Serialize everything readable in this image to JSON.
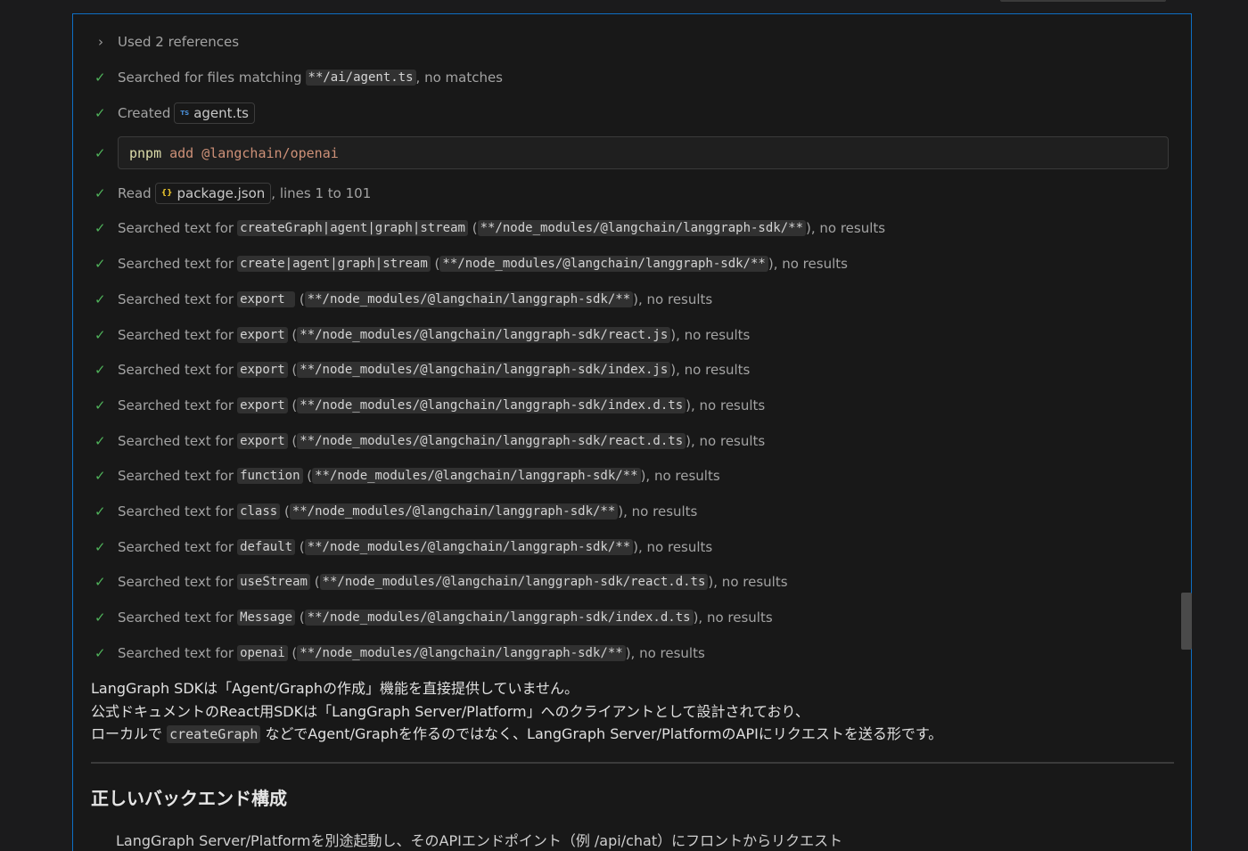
{
  "header": {
    "references_label": "Used 2 references"
  },
  "steps": [
    {
      "verb": "Searched for files matching",
      "code": "**/ai/agent.ts",
      "suffix": ", no matches"
    },
    {
      "verb": "Created",
      "file": "agent.ts",
      "file_icon": "typescript-icon",
      "file_icon_text": "TS"
    },
    {
      "command": {
        "bin": "pnpm",
        "args": "add @langchain/openai"
      }
    },
    {
      "verb": "Read",
      "file": "package.json",
      "file_icon": "json-icon",
      "file_icon_text": "{}",
      "suffix": ", lines 1 to 101"
    },
    {
      "verb": "Searched text for",
      "query": "createGraph|agent|graph|stream",
      "path": "**/node_modules/@langchain/langgraph-sdk/**",
      "suffix": "), no results"
    },
    {
      "verb": "Searched text for",
      "query": "create|agent|graph|stream",
      "path": "**/node_modules/@langchain/langgraph-sdk/**",
      "suffix": "), no results"
    },
    {
      "verb": "Searched text for",
      "query": "export ",
      "path": "**/node_modules/@langchain/langgraph-sdk/**",
      "suffix": "), no results"
    },
    {
      "verb": "Searched text for",
      "query": "export",
      "path": "**/node_modules/@langchain/langgraph-sdk/react.js",
      "suffix": "), no results"
    },
    {
      "verb": "Searched text for",
      "query": "export",
      "path": "**/node_modules/@langchain/langgraph-sdk/index.js",
      "suffix": "), no results"
    },
    {
      "verb": "Searched text for",
      "query": "export",
      "path": "**/node_modules/@langchain/langgraph-sdk/index.d.ts",
      "suffix": "), no results"
    },
    {
      "verb": "Searched text for",
      "query": "export",
      "path": "**/node_modules/@langchain/langgraph-sdk/react.d.ts",
      "suffix": "), no results"
    },
    {
      "verb": "Searched text for",
      "query": "function",
      "path": "**/node_modules/@langchain/langgraph-sdk/**",
      "suffix": "), no results"
    },
    {
      "verb": "Searched text for",
      "query": "class",
      "path": "**/node_modules/@langchain/langgraph-sdk/**",
      "suffix": "), no results"
    },
    {
      "verb": "Searched text for",
      "query": "default",
      "path": "**/node_modules/@langchain/langgraph-sdk/**",
      "suffix": "), no results"
    },
    {
      "verb": "Searched text for",
      "query": "useStream",
      "path": "**/node_modules/@langchain/langgraph-sdk/react.d.ts",
      "suffix": "), no results"
    },
    {
      "verb": "Searched text for",
      "query": "Message",
      "path": "**/node_modules/@langchain/langgraph-sdk/index.d.ts",
      "suffix": "), no results"
    },
    {
      "verb": "Searched text for",
      "query": "openai",
      "path": "**/node_modules/@langchain/langgraph-sdk/**",
      "suffix": "), no results"
    }
  ],
  "response": {
    "line1": "LangGraph SDKは「Agent/Graphの作成」機能を直接提供していません。",
    "line2": "公式ドキュメントのReact用SDKは「LangGraph Server/Platform」へのクライアントとして設計されており、",
    "line3_pre": "ローカルで ",
    "line3_code": "createGraph",
    "line3_post": " などでAgent/Graphを作るのではなく、LangGraph Server/PlatformのAPIにリクエストを送る形です。",
    "heading": "正しいバックエンド構成",
    "cut_line": "LangGraph Server/Platformを別途起動し、そのAPIエンドポイント（例 /api/chat）にフロントからリクエスト"
  },
  "colors": {
    "accent_border": "#0e6fc4",
    "check": "#4fb15a",
    "code_bg": "#313131"
  }
}
